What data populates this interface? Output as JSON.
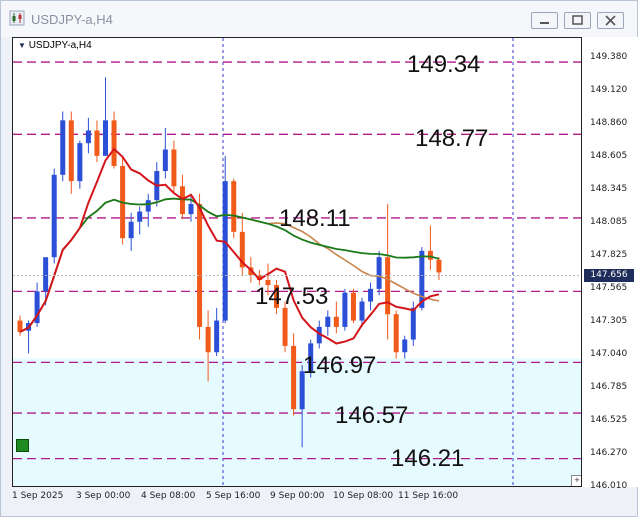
{
  "window": {
    "title": "USDJPY-a,H4"
  },
  "chart": {
    "symbol_label": "USDJPY-a,H4"
  },
  "price_axis": {
    "ticks": [
      "149.380",
      "149.120",
      "148.860",
      "148.605",
      "148.345",
      "148.085",
      "147.825",
      "147.565",
      "147.305",
      "147.040",
      "146.785",
      "146.525",
      "146.270",
      "146.010"
    ],
    "current_price": "147.656"
  },
  "time_axis": {
    "ticks": [
      "1 Sep 2025",
      "3 Sep 00:00",
      "4 Sep 08:00",
      "5 Sep 16:00",
      "9 Sep 00:00",
      "10 Sep 08:00",
      "11 Sep 16:00"
    ]
  },
  "levels": [
    "149.34",
    "148.77",
    "148.11",
    "147.53",
    "146.97",
    "146.57",
    "146.21"
  ],
  "colors": {
    "bull": "#2b4fd6",
    "bear": "#f05a1a",
    "level_line": "#b01a8a",
    "ma_red": "#d4161c",
    "ma_tan": "#c8844a",
    "ma_green": "#1a7a1a",
    "zone": "#e6fbff",
    "axis_bg": "#1e2d5a"
  }
}
